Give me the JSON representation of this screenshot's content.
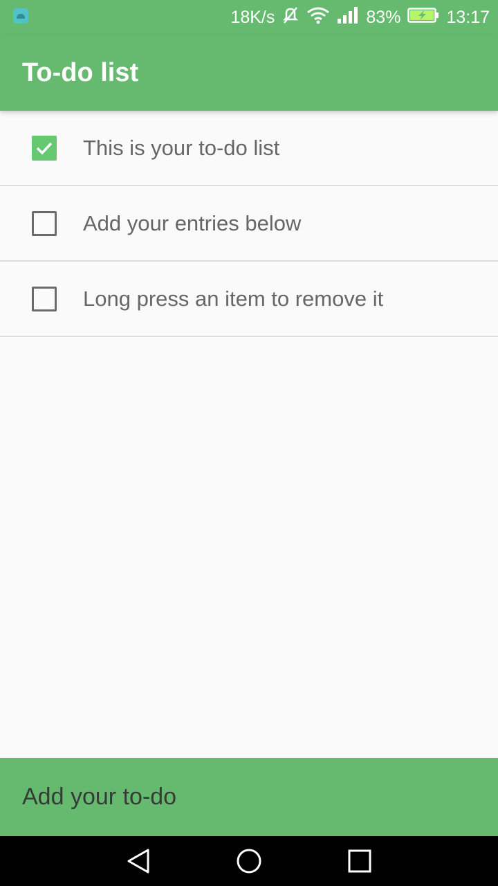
{
  "status_bar": {
    "net_speed": "18K/s",
    "battery": "83%",
    "time": "13:17"
  },
  "app_bar": {
    "title": "To-do list"
  },
  "todos": [
    {
      "label": "This is your to-do list",
      "checked": true
    },
    {
      "label": "Add your entries below",
      "checked": false
    },
    {
      "label": "Long press an item to remove it",
      "checked": false
    }
  ],
  "input": {
    "placeholder": "Add your to-do"
  },
  "colors": {
    "primary": "#66ba70",
    "check_accent": "#66c971"
  },
  "icons": {
    "status": [
      "android-notification-icon",
      "mute-icon",
      "wifi-icon",
      "signal-icon",
      "battery-charging-icon"
    ],
    "nav": [
      "back-icon",
      "home-icon",
      "recents-icon"
    ]
  }
}
